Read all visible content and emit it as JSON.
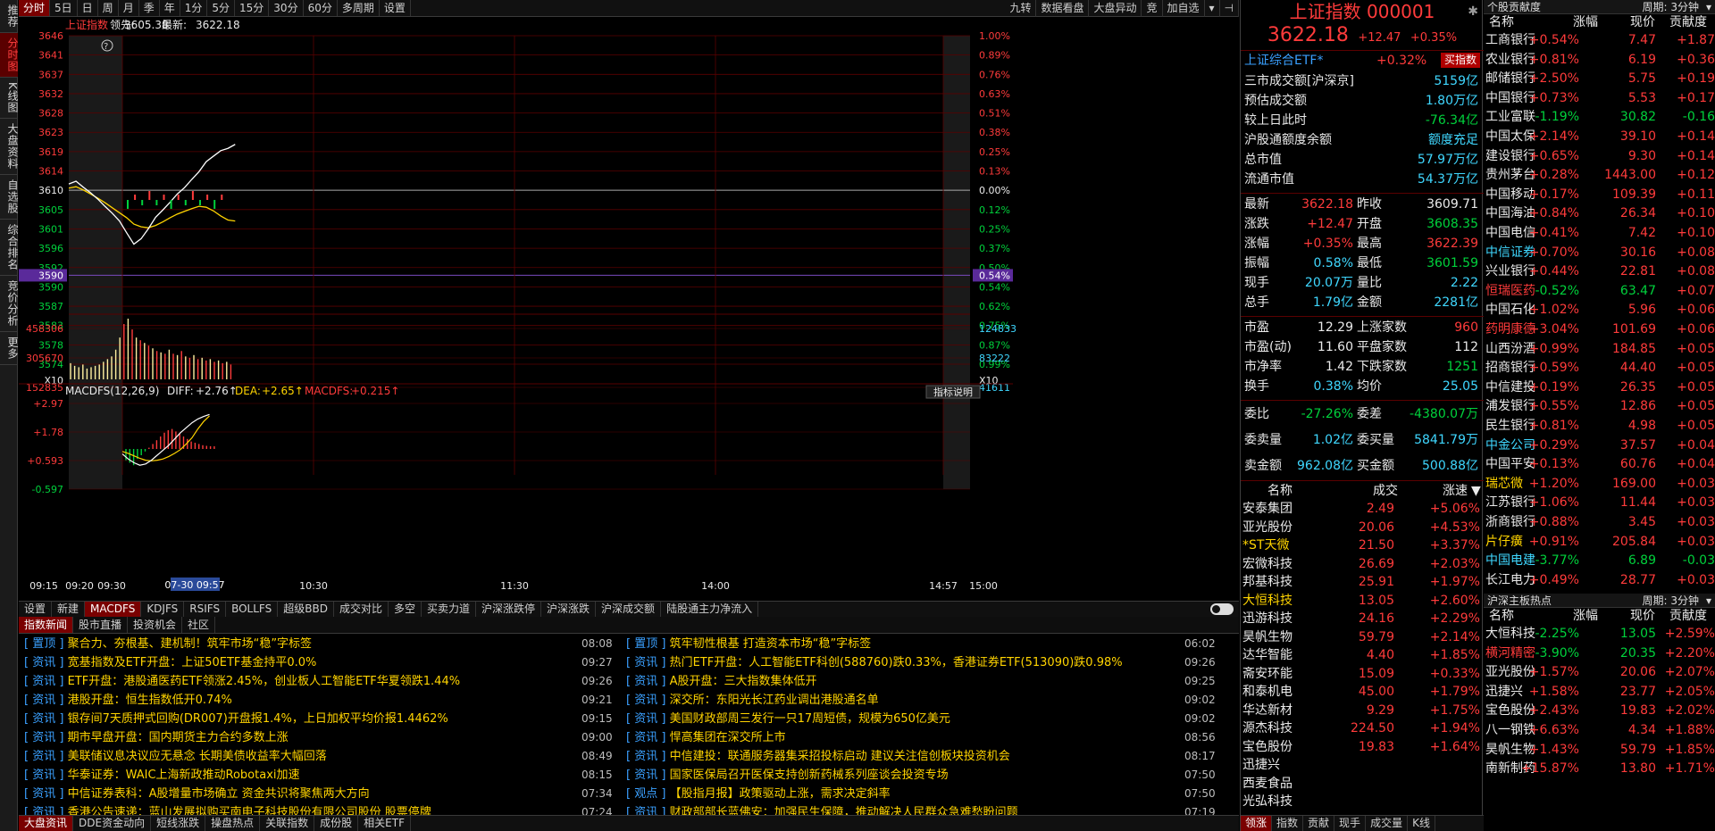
{
  "sidebar": [
    "推荐",
    "分时图",
    "K线图",
    "大盘资料",
    "自选股",
    "综合排名",
    "竞价分析",
    "更多"
  ],
  "toolbar": {
    "items": [
      "分时",
      "5日",
      "日",
      "周",
      "月",
      "季",
      "年",
      "1分",
      "5分",
      "15分",
      "30分",
      "60分",
      "多周期",
      "设置"
    ],
    "right": [
      "九转",
      "数据看盘",
      "大盘异动",
      "竞",
      "加自选"
    ]
  },
  "chart": {
    "name": "上证指数",
    "lead_label": "领先:",
    "lead": "3605.38",
    "latest_label": "最新:",
    "latest": "3622.18",
    "help_icon": "?",
    "price_ticks": [
      "3646",
      "3641",
      "3637",
      "3632",
      "3628",
      "3623",
      "3619",
      "3614",
      "3610",
      "3605",
      "3601",
      "3596",
      "3592",
      "3590",
      "3587",
      "3583",
      "3578",
      "3574"
    ],
    "pct_ticks": [
      "1.00%",
      "0.89%",
      "0.76%",
      "0.63%",
      "0.51%",
      "0.38%",
      "0.25%",
      "0.13%",
      "0.00%",
      "0.12%",
      "0.25%",
      "0.37%",
      "0.50%",
      "0.54%",
      "0.62%",
      "0.75%",
      "0.87%",
      "0.99%"
    ],
    "cursor_price": "3590",
    "cursor_pct": "0.54%",
    "vol_ticks_left": [
      "458306",
      "305670",
      "152835"
    ],
    "vol_ticks_right": [
      "124833",
      "83222",
      "41611"
    ],
    "vol_mult": "X10",
    "macd_header": {
      "name": "MACDFS(12,26,9)",
      "diff_label": "DIFF:",
      "diff": "+2.76↑",
      "dea_label": "DEA:",
      "dea": "+2.65↑",
      "macdfs_label": "MACDFS:",
      "macdfs": "+0.215↑"
    },
    "indicator_button": "指标说明",
    "macd_ticks": [
      "+2.97",
      "+1.78",
      "+0.593",
      "-0.597"
    ],
    "time_ticks": [
      "09:15",
      "09:20",
      "09:30",
      "10:30",
      "11:30",
      "14:00",
      "14:57",
      "15:00"
    ],
    "cursor_time": "07-30 09:57",
    "series": {
      "price": [
        3613.5,
        3614.1,
        3612.8,
        3611.6,
        3610.2,
        3608.6,
        3607.1,
        3605.4,
        3602.8,
        3600.3,
        3601.5,
        3603.7,
        3606.2,
        3607.8,
        3609.5,
        3611.3,
        3612.7,
        3614.5,
        3616.2,
        3618.4,
        3619.6,
        3620.8,
        3621.3,
        3622.18
      ],
      "avg": [
        3612.6,
        3612.9,
        3612.2,
        3611.3,
        3610.4,
        3609.4,
        3608.3,
        3607.2,
        3606.1,
        3604.7,
        3604.1,
        3603.9,
        3604.4,
        3605.2,
        3606.1,
        3606.9,
        3607.5,
        3608.1,
        3608.6,
        3608.4,
        3607.6,
        3606.5,
        3605.6,
        3605.38
      ],
      "volume": [
        12,
        10,
        9,
        11,
        8,
        9,
        10,
        11,
        13,
        15,
        17,
        22,
        31,
        41,
        45,
        37,
        31,
        29,
        27,
        25,
        23,
        21,
        20,
        19,
        22,
        19,
        18,
        21,
        17,
        16,
        18,
        15,
        16,
        14,
        15,
        13,
        14,
        12,
        13,
        11
      ],
      "diff": [
        -0.4,
        -0.8,
        -1.1,
        -1.3,
        -1.2,
        -0.9,
        -0.5,
        -0.1,
        0.3,
        0.8,
        1.3,
        1.7,
        2.1,
        2.4,
        2.6,
        2.76
      ],
      "dea": [
        -0.2,
        -0.35,
        -0.55,
        -0.75,
        -0.9,
        -0.95,
        -0.9,
        -0.8,
        -0.6,
        -0.35,
        -0.05,
        0.4,
        0.9,
        1.6,
        2.2,
        2.65
      ],
      "macd_bars": [
        -0.9,
        -1.1,
        -1.3,
        -0.8,
        -0.5,
        -0.2,
        0.1,
        0.4,
        0.7,
        1.0,
        1.3,
        1.5,
        1.6,
        1.4,
        1.2,
        1.0,
        0.8,
        0.6,
        0.5,
        0.4,
        0.3,
        0.25,
        0.22,
        0.215
      ]
    }
  },
  "tabs": [
    "设置",
    "新建",
    "MACDFS",
    "KDJFS",
    "RSIFS",
    "BOLLFS",
    "超级BBD",
    "成交对比",
    "多空",
    "买卖力道",
    "沪深涨跌停",
    "沪深涨跌",
    "沪深成交额",
    "陆股通主力净流入"
  ],
  "news_tabs": [
    "指数新闻",
    "股市直播",
    "投资机会",
    "社区"
  ],
  "news_left": [
    {
      "cat": "置顶",
      "title": "聚合力、夯根基、建机制！筑牢市场“稳”字标签",
      "time": "08:08"
    },
    {
      "cat": "资讯",
      "title": "宽基指数及ETF开盘：上证50ETF基金持平0.0%",
      "time": "09:27"
    },
    {
      "cat": "资讯",
      "title": "ETF开盘：港股通医药ETF领涨2.45%，创业板人工智能ETF华夏领跌1.44%",
      "time": "09:26"
    },
    {
      "cat": "资讯",
      "title": "港股开盘：恒生指数低开0.74%",
      "time": "09:21"
    },
    {
      "cat": "资讯",
      "title": "银存间7天质押式回购(DR007)开盘报1.4%，上日加权平均价报1.4462%",
      "time": "09:15"
    },
    {
      "cat": "资讯",
      "title": "期市早盘开盘：国内期货主力合约多数上涨",
      "time": "09:00"
    },
    {
      "cat": "资讯",
      "title": "美联储议息决议应无悬念 长期美债收益率大幅回落",
      "time": "08:49"
    },
    {
      "cat": "资讯",
      "title": "华泰证券：WAIC上海新政推动Robotaxi加速",
      "time": "08:15"
    },
    {
      "cat": "资讯",
      "title": "中信证券表科：A股增量市场确立 资金共识将聚焦两大方向",
      "time": "07:34"
    },
    {
      "cat": "资讯",
      "title": "香港公告速递：蓝山发展拟购买南电子科技股份有限公司股份 股票停牌",
      "time": "07:24"
    }
  ],
  "news_right": [
    {
      "cat": "置顶",
      "title": "筑牢韧性根基 打造资本市场“稳”字标签",
      "time": "06:02"
    },
    {
      "cat": "资讯",
      "title": "热门ETF开盘：人工智能ETF科创(588760)跌0.33%，香港证券ETF(513090)跌0.98%",
      "time": "09:26"
    },
    {
      "cat": "资讯",
      "title": "A股开盘：三大指数集体低开",
      "time": "09:25"
    },
    {
      "cat": "资讯",
      "title": "深交所：东阳光长江药业调出港股通名单",
      "time": "09:02"
    },
    {
      "cat": "资讯",
      "title": "美国财政部周三发行一只17周短债，规模为650亿美元",
      "time": "09:02"
    },
    {
      "cat": "资讯",
      "title": "悍高集团在深交所上市",
      "time": "08:56"
    },
    {
      "cat": "资讯",
      "title": "中信建投：联通服务器集采招投标启动 建议关注信创板块投资机会",
      "time": "08:17"
    },
    {
      "cat": "资讯",
      "title": "国家医保局召开医保支持创新药械系列座谈会投资专场",
      "time": "07:50"
    },
    {
      "cat": "观点",
      "title": "【股指月报】政策驱动上涨，需求决定斜率",
      "time": "07:50"
    },
    {
      "cat": "资讯",
      "title": "财政部部长蓝佛安：加强民生保障，推动解决人民群众急难愁盼问题",
      "time": "07:19"
    }
  ],
  "bottom_tabs": [
    "大盘资讯",
    "DDE资金动向",
    "短线涨跌",
    "操盘热点",
    "关联指数",
    "成份股",
    "相关ETF"
  ],
  "quote": {
    "title": "上证指数",
    "code": "000001",
    "price": "3622.18",
    "change": "+12.47",
    "pct": "+0.35%",
    "etf_name": "上证综合ETF*",
    "etf_pct": "+0.32%",
    "etf_button": "买指数",
    "stats": [
      {
        "label": "三市成交额[沪深京]",
        "value": "5159亿",
        "color": "cyn"
      },
      {
        "label": "预估成交额",
        "value": "1.80万亿",
        "color": "cyn"
      },
      {
        "label": "较上日此时",
        "value": "-76.34亿",
        "color": "grn"
      },
      {
        "label": "沪股通额度余额",
        "value": "额度充足",
        "color": "cyn"
      },
      {
        "label": "总市值",
        "value": "57.97万亿",
        "color": "cyn"
      },
      {
        "label": "流通市值",
        "value": "54.37万亿",
        "color": "cyn"
      }
    ],
    "grid": [
      {
        "l1": "最新",
        "v1": "3622.18",
        "c1": "red",
        "l2": "昨收",
        "v2": "3609.71",
        "c2": "wht"
      },
      {
        "l1": "涨跌",
        "v1": "+12.47",
        "c1": "red",
        "l2": "开盘",
        "v2": "3608.35",
        "c2": "grn"
      },
      {
        "l1": "涨幅",
        "v1": "+0.35%",
        "c1": "red",
        "l2": "最高",
        "v2": "3622.39",
        "c2": "red"
      },
      {
        "l1": "振幅",
        "v1": "0.58%",
        "c1": "cyn",
        "l2": "最低",
        "v2": "3601.59",
        "c2": "grn"
      },
      {
        "l1": "现手",
        "v1": "20.07万",
        "c1": "cyn",
        "l2": "量比",
        "v2": "2.22",
        "c2": "cyn"
      },
      {
        "l1": "总手",
        "v1": "1.79亿",
        "c1": "cyn",
        "l2": "金额",
        "v2": "2281亿",
        "c2": "cyn"
      }
    ],
    "grid2": [
      {
        "l1": "市盈",
        "v1": "12.29",
        "c1": "wht",
        "l2": "上涨家数",
        "v2": "960",
        "c2": "red"
      },
      {
        "l1": "市盈(动)",
        "v1": "11.60",
        "c1": "wht",
        "l2": "平盘家数",
        "v2": "112",
        "c2": "wht"
      },
      {
        "l1": "市净率",
        "v1": "1.42",
        "c1": "wht",
        "l2": "下跌家数",
        "v2": "1251",
        "c2": "grn"
      },
      {
        "l1": "换手",
        "v1": "0.38%",
        "c1": "cyn",
        "l2": "均价",
        "v2": "25.05",
        "c2": "cyn"
      }
    ],
    "grid3": [
      {
        "l1": "委比",
        "v1": "-27.26%",
        "c1": "grn",
        "l2": "委差",
        "v2": "-4380.07万",
        "c2": "grn"
      },
      {
        "l1": "委卖量",
        "v1": "1.02亿",
        "c1": "cyn",
        "l2": "委买量",
        "v2": "5841.79万",
        "c2": "cyn"
      },
      {
        "l1": "卖金额",
        "v1": "962.08亿",
        "c1": "cyn",
        "l2": "买金额",
        "v2": "500.88亿",
        "c2": "cyn"
      }
    ],
    "list_header": {
      "name": "名称",
      "price": "成交",
      "pct": "涨速"
    },
    "list": [
      {
        "name": "安泰集团",
        "price": "2.49",
        "pct": "+5.06%",
        "nc": "wht"
      },
      {
        "name": "亚光股份",
        "price": "20.06",
        "pct": "+4.53%",
        "nc": "wht"
      },
      {
        "name": "*ST天微",
        "price": "21.50",
        "pct": "+3.37%",
        "nc": "yel"
      },
      {
        "name": "宏微科技",
        "price": "26.69",
        "pct": "+2.03%",
        "nc": "wht"
      },
      {
        "name": "邦基科技",
        "price": "25.91",
        "pct": "+1.97%",
        "nc": "wht"
      },
      {
        "name": "大恒科技",
        "price": "13.05",
        "pct": "+2.60%",
        "nc": "yel"
      },
      {
        "name": "迅游科技",
        "price": "24.16",
        "pct": "+2.29%",
        "nc": "wht"
      },
      {
        "name": "昊帆生物",
        "price": "59.79",
        "pct": "+2.14%",
        "nc": "wht"
      },
      {
        "name": "达华智能",
        "price": "4.40",
        "pct": "+1.85%",
        "nc": "wht"
      },
      {
        "name": "斋安环能",
        "price": "15.09",
        "pct": "+0.33%",
        "nc": "wht"
      },
      {
        "name": "和泰机电",
        "price": "45.00",
        "pct": "+1.79%",
        "nc": "wht"
      },
      {
        "name": "华达新材",
        "price": "9.29",
        "pct": "+1.75%",
        "nc": "wht"
      },
      {
        "name": "源杰科技",
        "price": "224.50",
        "pct": "+1.94%",
        "nc": "wht"
      },
      {
        "name": "宝色股份",
        "price": "19.83",
        "pct": "+1.64%",
        "nc": "wht"
      },
      {
        "name": "迅捷兴",
        "price": "",
        "pct": "",
        "nc": "wht"
      },
      {
        "name": "西麦食品",
        "price": "",
        "pct": "",
        "nc": "wht"
      },
      {
        "name": "光弘科技",
        "price": "",
        "pct": "",
        "nc": "wht"
      }
    ],
    "bottom_tabs": [
      "领涨",
      "指数",
      "贡献",
      "现手",
      "成交量",
      "K线"
    ]
  },
  "right": {
    "header1": {
      "title": "个股贡献度",
      "period": "周期: 3分钟"
    },
    "cols": {
      "name": "名称",
      "pct": "涨幅",
      "price": "现价",
      "contrib": "贡献度"
    },
    "rows1": [
      {
        "name": "工商银行",
        "pct": "+0.54%",
        "price": "7.47",
        "contrib": "+1.87"
      },
      {
        "name": "农业银行",
        "pct": "+0.81%",
        "price": "6.19",
        "contrib": "+0.36"
      },
      {
        "name": "邮储银行",
        "pct": "+2.50%",
        "price": "5.75",
        "contrib": "+0.19"
      },
      {
        "name": "中国银行",
        "pct": "+0.73%",
        "price": "5.53",
        "contrib": "+0.17"
      },
      {
        "name": "工业富联",
        "pct": "-1.19%",
        "price": "30.82",
        "contrib": "-0.16"
      },
      {
        "name": "中国太保",
        "pct": "+2.14%",
        "price": "39.10",
        "contrib": "+0.14"
      },
      {
        "name": "建设银行",
        "pct": "+0.65%",
        "price": "9.30",
        "contrib": "+0.14"
      },
      {
        "name": "贵州茅台",
        "pct": "+0.28%",
        "price": "1443.00",
        "contrib": "+0.12"
      },
      {
        "name": "中国移动",
        "pct": "+0.17%",
        "price": "109.39",
        "contrib": "+0.11"
      },
      {
        "name": "中国海油",
        "pct": "+0.84%",
        "price": "26.34",
        "contrib": "+0.10"
      },
      {
        "name": "中国电信",
        "pct": "+0.41%",
        "price": "7.42",
        "contrib": "+0.10"
      },
      {
        "name": "中信证券",
        "pct": "+0.70%",
        "price": "30.16",
        "contrib": "+0.08"
      },
      {
        "name": "兴业银行",
        "pct": "+0.44%",
        "price": "22.81",
        "contrib": "+0.08"
      },
      {
        "name": "恒瑞医药",
        "pct": "-0.52%",
        "price": "63.47",
        "contrib": "+0.07"
      },
      {
        "name": "中国石化",
        "pct": "+1.02%",
        "price": "5.96",
        "contrib": "+0.06"
      },
      {
        "name": "药明康德",
        "pct": "+3.04%",
        "price": "101.69",
        "contrib": "+0.06"
      },
      {
        "name": "山西汾酒",
        "pct": "+0.99%",
        "price": "184.85",
        "contrib": "+0.05"
      },
      {
        "name": "招商银行",
        "pct": "+0.59%",
        "price": "44.40",
        "contrib": "+0.05"
      },
      {
        "name": "中信建投",
        "pct": "+0.19%",
        "price": "26.35",
        "contrib": "+0.05"
      },
      {
        "name": "浦发银行",
        "pct": "+0.55%",
        "price": "12.86",
        "contrib": "+0.05"
      },
      {
        "name": "民生银行",
        "pct": "+0.81%",
        "price": "4.98",
        "contrib": "+0.05"
      },
      {
        "name": "中金公司",
        "pct": "+0.29%",
        "price": "37.57",
        "contrib": "+0.04"
      },
      {
        "name": "中国平安",
        "pct": "+0.13%",
        "price": "60.76",
        "contrib": "+0.04"
      },
      {
        "name": "瑞芯微",
        "pct": "+1.20%",
        "price": "169.00",
        "contrib": "+0.03"
      },
      {
        "name": "江苏银行",
        "pct": "+1.06%",
        "price": "11.44",
        "contrib": "+0.03"
      },
      {
        "name": "浙商银行",
        "pct": "+0.88%",
        "price": "3.45",
        "contrib": "+0.03"
      },
      {
        "name": "片仔癀",
        "pct": "+0.91%",
        "price": "205.84",
        "contrib": "+0.03"
      },
      {
        "name": "中国电建",
        "pct": "-3.77%",
        "price": "6.89",
        "contrib": "-0.03"
      },
      {
        "name": "长江电力",
        "pct": "+0.49%",
        "price": "28.77",
        "contrib": "+0.03"
      }
    ],
    "header2": {
      "title": "沪深主板热点",
      "period": "周期: 3分钟"
    },
    "rows2": [
      {
        "name": "大恒科技",
        "pct": "-2.25%",
        "price": "13.05",
        "contrib": "+2.59%"
      },
      {
        "name": "横河精密",
        "pct": "-3.90%",
        "price": "20.35",
        "contrib": "+2.20%"
      },
      {
        "name": "亚光股份",
        "pct": "+1.57%",
        "price": "20.06",
        "contrib": "+2.07%"
      },
      {
        "name": "迅捷兴",
        "pct": "+1.58%",
        "price": "23.77",
        "contrib": "+2.05%"
      },
      {
        "name": "宝色股份",
        "pct": "+2.43%",
        "price": "19.83",
        "contrib": "+2.02%"
      },
      {
        "name": "八一钢铁",
        "pct": "+6.63%",
        "price": "4.34",
        "contrib": "+1.88%"
      },
      {
        "name": "昊帆生物",
        "pct": "+1.43%",
        "price": "59.79",
        "contrib": "+1.85%"
      },
      {
        "name": "南新制药",
        "pct": "+15.87%",
        "price": "13.80",
        "contrib": "+1.71%"
      }
    ],
    "row_colors": {
      "中信证券": "#3fd7ff",
      "恒瑞医药": "#ff3b3b",
      "药明康德": "#ff3b3b",
      "中金公司": "#3fd7ff",
      "瑞芯微": "#ffd400",
      "片仔癀": "#ffd400",
      "中国电建": "#3fd7ff",
      "横河精密": "#ff3b3b"
    }
  }
}
